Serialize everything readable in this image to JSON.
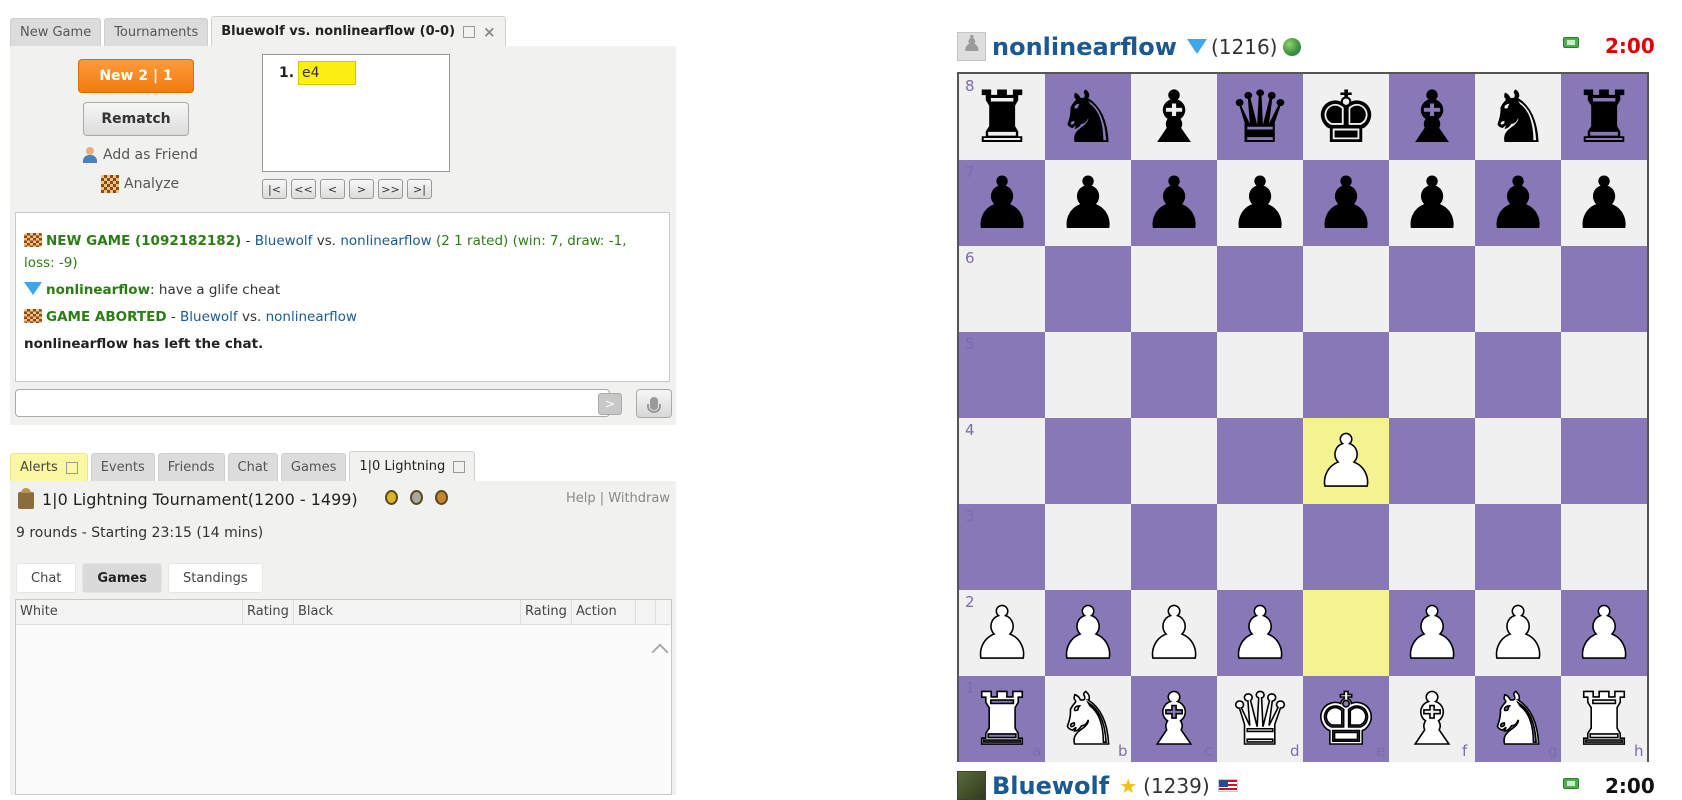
{
  "top_tabs": [
    {
      "label": "New Game",
      "active": false
    },
    {
      "label": "Tournaments",
      "active": false
    },
    {
      "label": "Bluewolf vs. nonlinearflow (0-0)",
      "active": true
    }
  ],
  "game_panel": {
    "new_button": "New 2 | 1",
    "rematch_button": "Rematch",
    "add_friend": "Add as Friend",
    "analyze": "Analyze",
    "moves": [
      {
        "num": "1.",
        "white": "e4"
      }
    ],
    "nav": [
      "|<",
      "<<",
      "<",
      ">",
      ">>",
      ">|"
    ]
  },
  "chat": {
    "line1": {
      "new_game": "NEW GAME (1092182182)",
      "dash": " - ",
      "white": "Bluewolf",
      "vs": " vs. ",
      "black": "nonlinearflow",
      "rest": " (2 1 rated) (win: 7, draw: -1, loss: -9)"
    },
    "line2": {
      "user": "nonlinearflow",
      "text": ": have a glife cheat"
    },
    "line3": {
      "aborted": "GAME ABORTED",
      "dash": " - ",
      "white": "Bluewolf",
      "vs": " vs. ",
      "black": "nonlinearflow"
    },
    "line4": "nonlinearflow has left the chat.",
    "send_icon": ">",
    "input_value": ""
  },
  "bottom_tabs": [
    {
      "label": "Alerts",
      "active": false
    },
    {
      "label": "Events",
      "active": false
    },
    {
      "label": "Friends",
      "active": false
    },
    {
      "label": "Chat",
      "active": false
    },
    {
      "label": "Games",
      "active": false
    },
    {
      "label": "1|0 Lightning",
      "active": true
    }
  ],
  "tournament": {
    "title": "1|0 Lightning Tournament(1200 - 1499)",
    "help": "Help",
    "sep": " | ",
    "withdraw": "Withdraw",
    "subtitle": "9 rounds - Starting 23:15 (14 mins)",
    "tabs": [
      {
        "label": "Chat",
        "active": false
      },
      {
        "label": "Games",
        "active": true
      },
      {
        "label": "Standings",
        "active": false
      }
    ],
    "columns": [
      "White",
      "Rating",
      "Black",
      "Rating",
      "Action"
    ],
    "medal_colors": [
      "#d9b526",
      "#a7a7a7",
      "#c9842c"
    ]
  },
  "top_player": {
    "name": "nonlinearflow",
    "rating": "(1216)",
    "clock": "2:00",
    "clock_color": "#e00000",
    "badge": "diamond-icon",
    "country": "globe-icon"
  },
  "bottom_player": {
    "name": "Bluewolf",
    "rating": "(1239)",
    "clock": "2:00",
    "clock_color": "#111111",
    "badge": "star-icon",
    "country": "us-flag-icon"
  },
  "board": {
    "light": "#f0f0f0",
    "dark": "#8878b8",
    "highlight": "#f5f292",
    "highlight_squares": [
      "e2",
      "e4"
    ],
    "files": [
      "a",
      "b",
      "c",
      "d",
      "e",
      "f",
      "g",
      "h"
    ],
    "ranks": [
      "8",
      "7",
      "6",
      "5",
      "4",
      "3",
      "2",
      "1"
    ],
    "position": [
      "rnbqkbnr",
      "pppppppp",
      "........",
      "........",
      "....P...",
      "........",
      "PPPP.PPP",
      "RNBQKBNR"
    ]
  }
}
